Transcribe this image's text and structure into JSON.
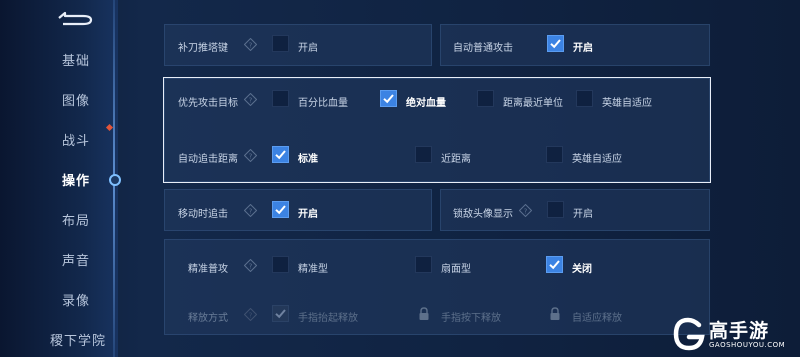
{
  "nav": {
    "items": [
      {
        "label": "基础"
      },
      {
        "label": "图像"
      },
      {
        "label": "战斗"
      },
      {
        "label": "操作"
      },
      {
        "label": "布局"
      },
      {
        "label": "声音"
      },
      {
        "label": "录像"
      },
      {
        "label": "稷下学院"
      }
    ],
    "active_index": 3,
    "badge_index": 2
  },
  "settings": {
    "last_hit": {
      "label": "补刀推塔键",
      "option": "开启",
      "checked": false
    },
    "auto_attack": {
      "label": "自动普通攻击",
      "option": "开启",
      "checked": true
    },
    "priority_target": {
      "label": "优先攻击目标",
      "options": [
        {
          "label": "百分比血量",
          "checked": false
        },
        {
          "label": "绝对血量",
          "checked": true
        },
        {
          "label": "距离最近单位",
          "checked": false
        },
        {
          "label": "英雄自适应",
          "checked": false
        }
      ]
    },
    "auto_chase": {
      "label": "自动追击距离",
      "options": [
        {
          "label": "标准",
          "checked": true
        },
        {
          "label": "近距离",
          "checked": false
        },
        {
          "label": "英雄自适应",
          "checked": false
        }
      ]
    },
    "move_chase": {
      "label": "移动时追击",
      "option": "开启",
      "checked": true
    },
    "lock_avatar": {
      "label": "锁敌头像显示",
      "option": "开启",
      "checked": false
    },
    "precise_attack": {
      "label": "精准普攻",
      "options": [
        {
          "label": "精准型",
          "checked": false
        },
        {
          "label": "扇面型",
          "checked": false
        },
        {
          "label": "关闭",
          "checked": true
        }
      ]
    },
    "release_mode": {
      "label": "释放方式",
      "options": [
        {
          "label": "手指抬起释放",
          "state": "disabled-checked"
        },
        {
          "label": "手指按下释放",
          "state": "locked"
        },
        {
          "label": "自适应释放",
          "state": "locked"
        }
      ]
    }
  },
  "watermark": {
    "title": "高手游",
    "url": "GAOSHOUYOU.COM"
  },
  "colors": {
    "accent": "#3c83e3",
    "badge": "#e2553a",
    "background": "#13284a"
  }
}
